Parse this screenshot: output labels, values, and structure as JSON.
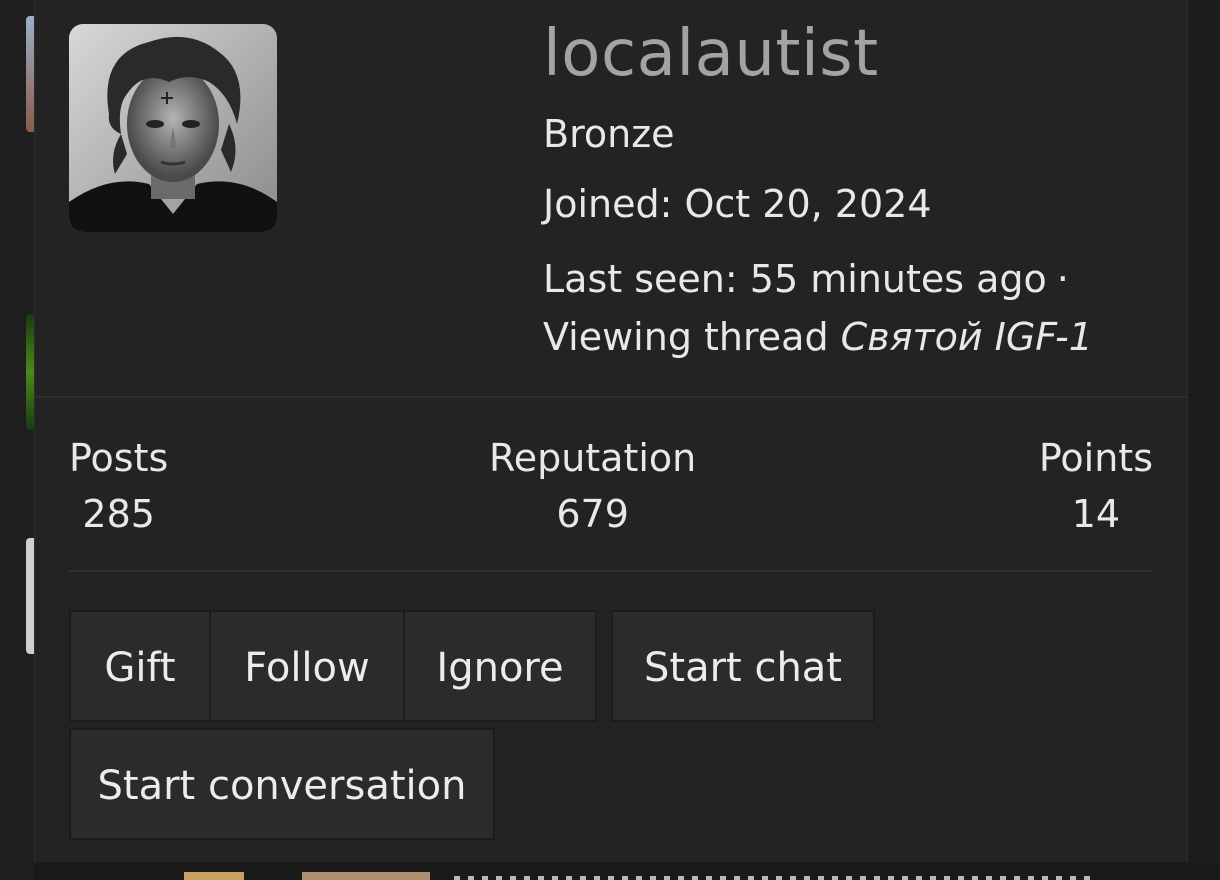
{
  "profile": {
    "username": "localautist",
    "rank": "Bronze",
    "joined_label": "Joined:",
    "joined_value": "Oct 20, 2024",
    "last_seen_label": "Last seen:",
    "last_seen_value": "55 minutes ago",
    "separator": "·",
    "activity_prefix": "Viewing thread",
    "activity_thread": "Святой IGF-1"
  },
  "stats": {
    "posts_label": "Posts",
    "posts_value": "285",
    "reputation_label": "Reputation",
    "reputation_value": "679",
    "points_label": "Points",
    "points_value": "14"
  },
  "actions": {
    "gift": "Gift",
    "follow": "Follow",
    "ignore": "Ignore",
    "start_chat": "Start chat",
    "start_conversation": "Start conversation"
  },
  "colors": {
    "card_bg": "#232323",
    "username": "#a3a3a3",
    "text": "#e8e8e8",
    "button_bg": "#2b2b2b"
  }
}
